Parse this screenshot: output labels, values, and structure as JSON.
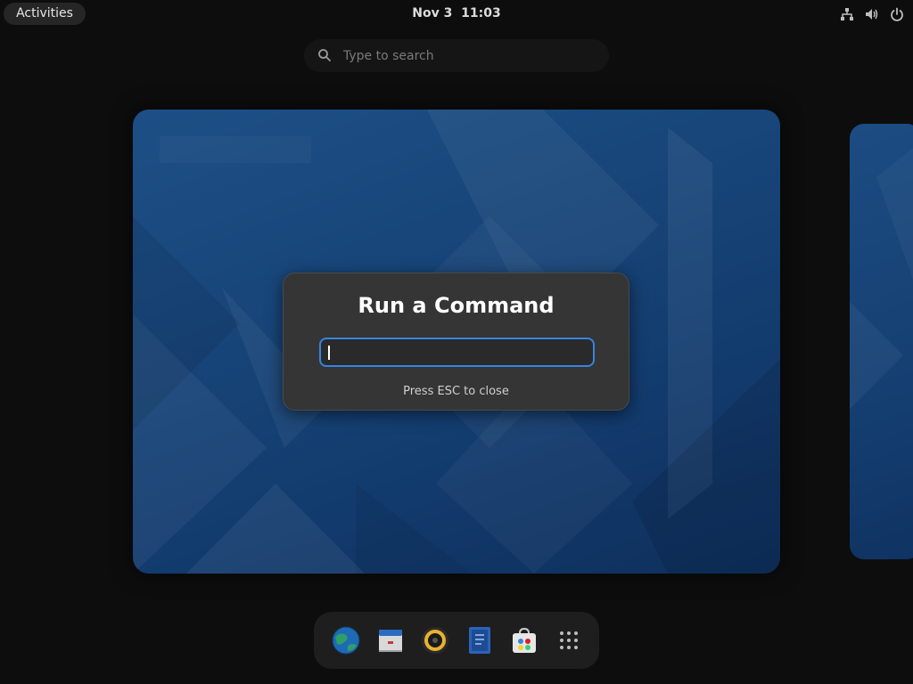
{
  "topbar": {
    "activities_label": "Activities",
    "date": "Nov 3",
    "time": "11:03",
    "tray_icons": [
      "network-icon",
      "volume-icon",
      "power-icon"
    ]
  },
  "search": {
    "placeholder": "Type to search",
    "value": ""
  },
  "dialog": {
    "title": "Run a Command",
    "input_value": "",
    "hint": "Press ESC to close"
  },
  "dock": {
    "items": [
      "browser-icon",
      "calendar-icon",
      "speaker-icon",
      "text-editor-icon",
      "software-store-icon",
      "app-grid-icon"
    ]
  },
  "colors": {
    "accent": "#3584e4",
    "dialog_bg": "#353535",
    "wallpaper": "#174478"
  }
}
